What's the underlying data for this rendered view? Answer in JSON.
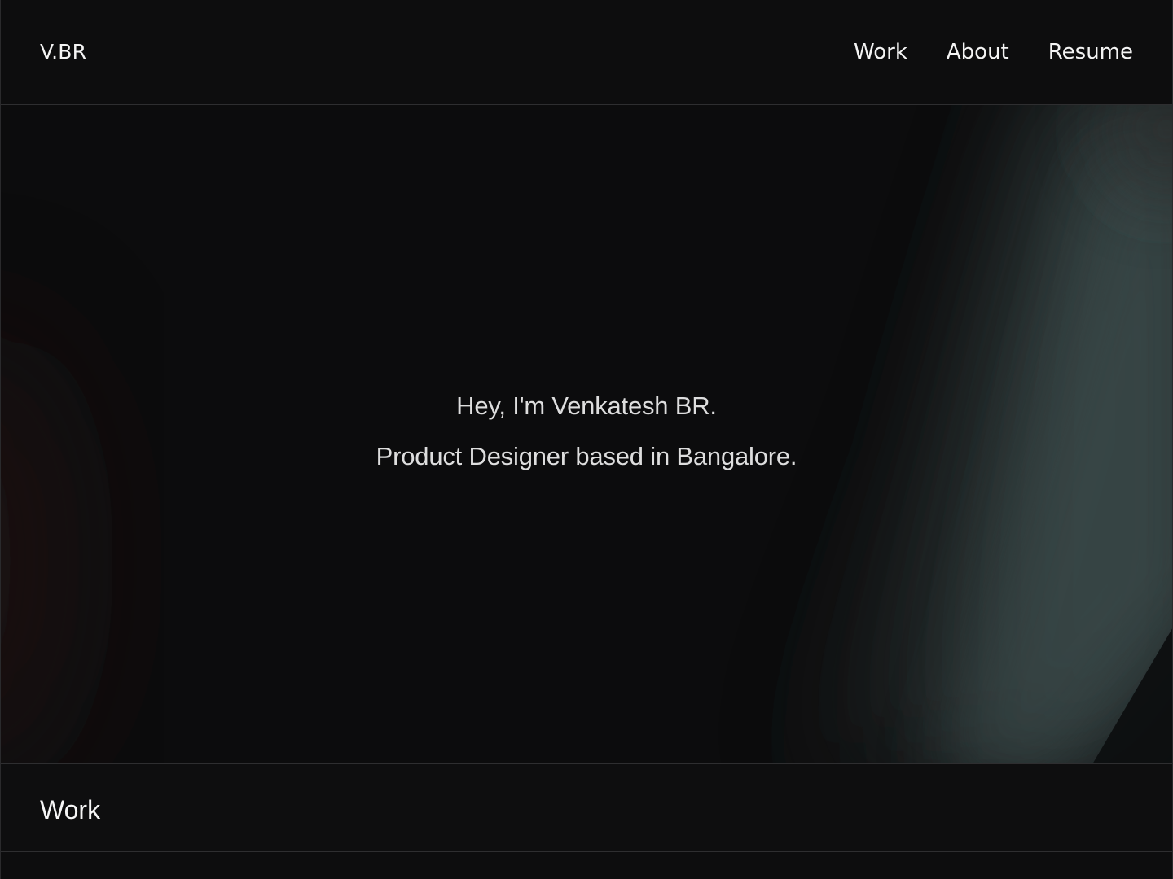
{
  "header": {
    "logo": "V.BR",
    "nav": [
      {
        "label": "Work"
      },
      {
        "label": "About"
      },
      {
        "label": "Resume"
      }
    ]
  },
  "hero": {
    "line1": "Hey, I'm Venkatesh BR.",
    "line2": "Product Designer based in Bangalore."
  },
  "work": {
    "title": "Work"
  },
  "colors": {
    "background": "#0d0d0e",
    "accent_glow": "#3a4a4a",
    "border": "#2e2e30"
  }
}
